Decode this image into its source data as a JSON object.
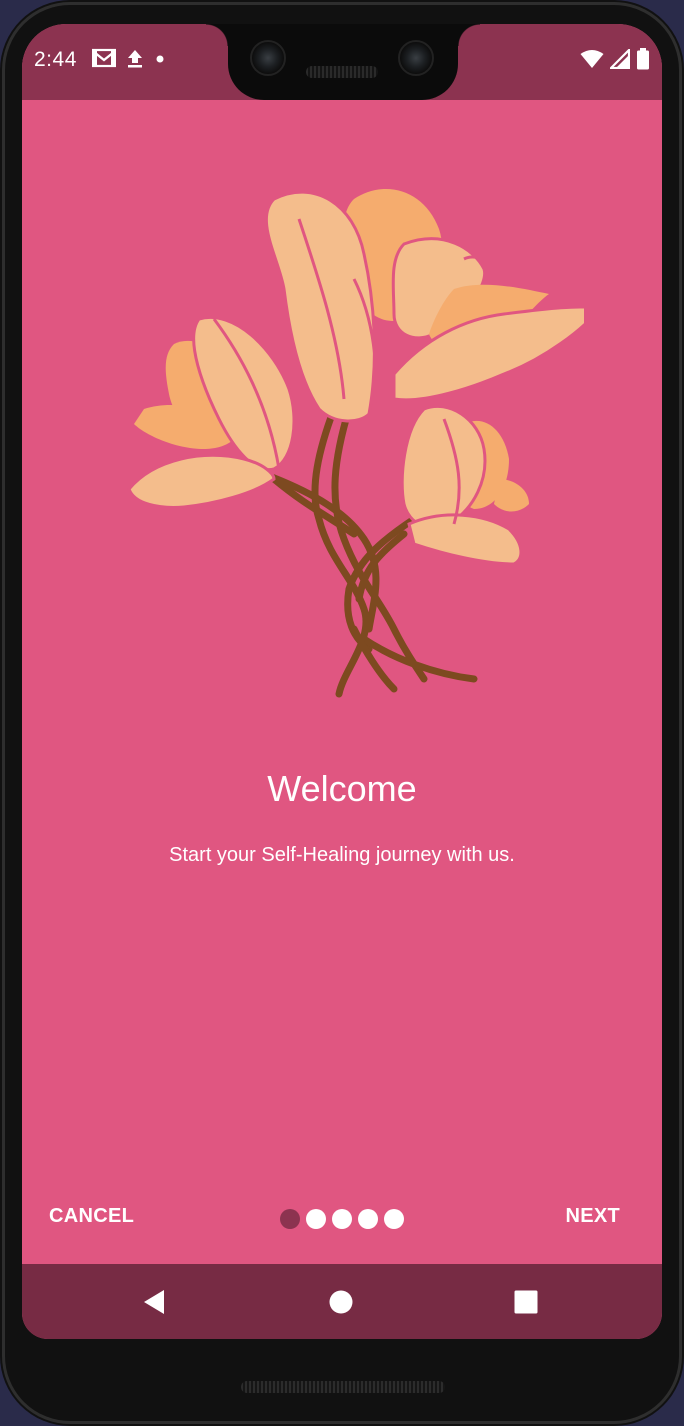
{
  "status_bar": {
    "time": "2:44",
    "left_icons": [
      "gmail-icon",
      "upload-icon",
      "dot-icon"
    ],
    "right_icons": [
      "wifi-icon",
      "signal-icon",
      "battery-icon"
    ]
  },
  "onboarding": {
    "title": "Welcome",
    "subtitle": "Start your Self-Healing journey with us.",
    "illustration": "flower-illustration",
    "page_index": 1,
    "page_count": 5
  },
  "controls": {
    "cancel_label": "CANCEL",
    "next_label": "NEXT"
  },
  "nav_bar": {
    "icons": [
      "back-icon",
      "home-icon",
      "recents-icon"
    ]
  },
  "colors": {
    "background": "#e05681",
    "status_bar": "#8c3350",
    "nav_bar": "#772b44",
    "active_dot": "#8c3350",
    "inactive_dot": "#ffffff",
    "petal": "#f4bd8c",
    "petal_accent": "#f5ac6e",
    "stem": "#7d4a20"
  }
}
